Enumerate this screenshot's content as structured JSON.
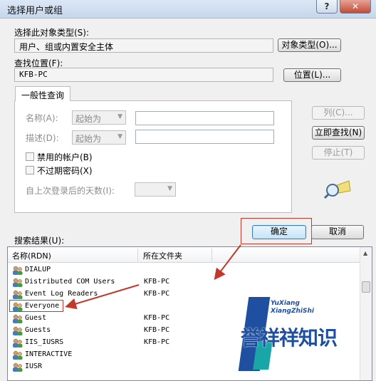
{
  "window": {
    "title": "选择用户或组",
    "help_label": "?",
    "close_label": "✕"
  },
  "object_type": {
    "label": "选择此对象类型(S):",
    "value": "用户、组或内置安全主体",
    "button": "对象类型(O)..."
  },
  "location": {
    "label": "查找位置(F):",
    "value": "KFB-PC",
    "button": "位置(L)..."
  },
  "query_tab": {
    "label": "一般性查询"
  },
  "query": {
    "name_label": "名称(A):",
    "name_mode": "起始为",
    "desc_label": "描述(D):",
    "desc_mode": "起始为",
    "disabled_accounts": "禁用的帐户(B)",
    "no_expire_pwd": "不过期密码(X)",
    "days_since_login": "自上次登录后的天数(I):"
  },
  "side_buttons": {
    "columns": "列(C)...",
    "find_now": "立即查找(N)",
    "stop": "停止(T)"
  },
  "ok_label": "确定",
  "cancel_label": "取消",
  "results": {
    "label": "搜索结果(U):",
    "columns": [
      "名称(RDN)",
      "所在文件夹"
    ],
    "rows": [
      {
        "name": "DIALUP",
        "folder": ""
      },
      {
        "name": "Distributed COM Users",
        "folder": "KFB-PC"
      },
      {
        "name": "Event Log Readers",
        "folder": "KFB-PC"
      },
      {
        "name": "Everyone",
        "folder": ""
      },
      {
        "name": "Guest",
        "folder": "KFB-PC"
      },
      {
        "name": "Guests",
        "folder": "KFB-PC"
      },
      {
        "name": "IIS_IUSRS",
        "folder": "KFB-PC"
      },
      {
        "name": "INTERACTIVE",
        "folder": ""
      },
      {
        "name": "IUSR",
        "folder": ""
      }
    ]
  },
  "watermark": {
    "line1": "YuXiang",
    "line2": "XiangZhiShi",
    "text": "誉祥祥知识"
  },
  "colors": {
    "accent_red": "#c0392b",
    "watermark_blue": "#1f4fa0",
    "watermark_teal": "#1aa6a6"
  }
}
